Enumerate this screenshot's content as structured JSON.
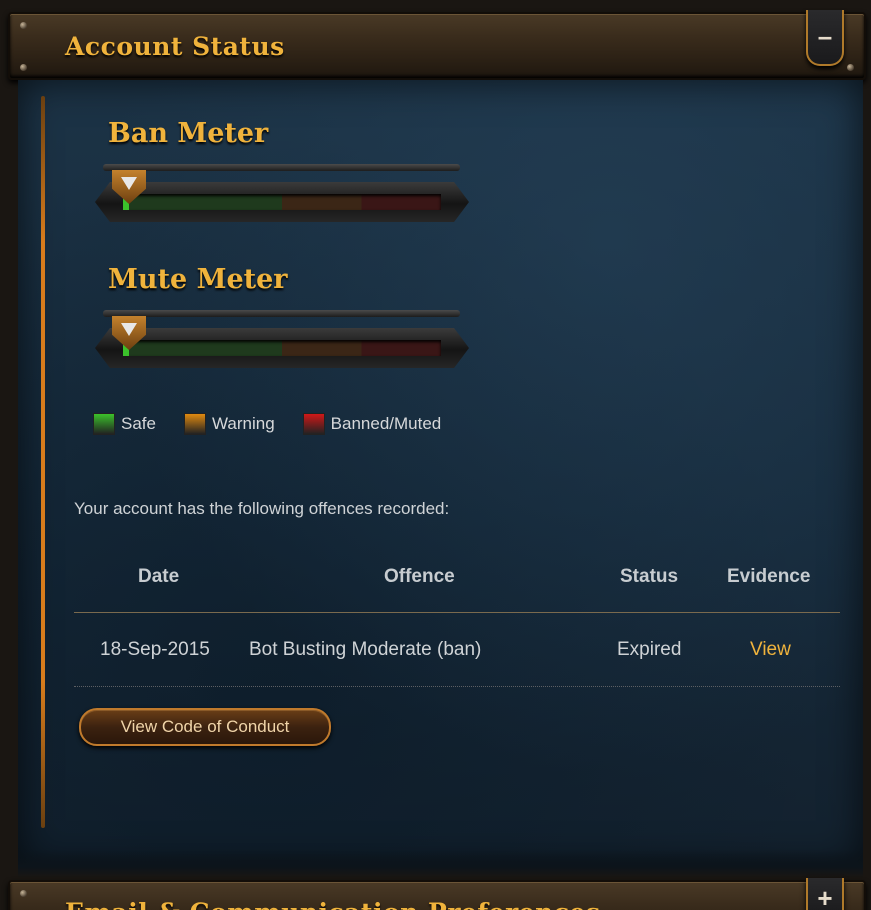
{
  "account_status": {
    "title": "Account Status",
    "collapse_symbol": "–"
  },
  "ban_meter": {
    "title": "Ban Meter",
    "level": 0.0
  },
  "mute_meter": {
    "title": "Mute Meter",
    "level": 0.0
  },
  "legend": {
    "items": [
      {
        "label": "Safe",
        "color": "#3bc22b"
      },
      {
        "label": "Warning",
        "color": "#e08a10"
      },
      {
        "label": "Banned/Muted",
        "color": "#d01818"
      }
    ]
  },
  "offences": {
    "intro": "Your account has the following offences recorded:",
    "headers": [
      "Date",
      "Offence",
      "Status",
      "Evidence"
    ],
    "rows": [
      {
        "date": "18-Sep-2015",
        "offence": "Bot Busting Moderate (ban)",
        "status": "Expired",
        "evidence": "View"
      }
    ]
  },
  "code_of_conduct_button": "View Code of Conduct",
  "email_prefs": {
    "title": "Email & Communication Preferences",
    "expand_symbol": "+"
  },
  "colors": {
    "accent_gold": "#f0b33c",
    "panel_blue": "#1c3346"
  }
}
